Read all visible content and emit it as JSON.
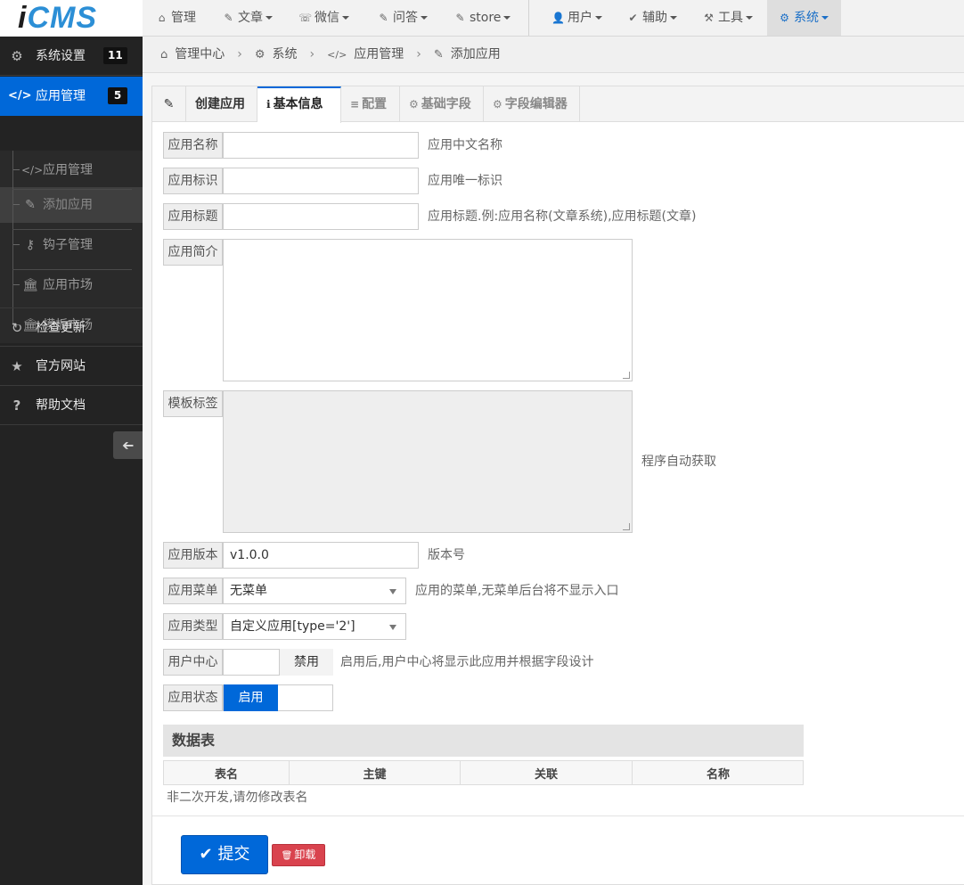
{
  "brand": {
    "logo_i": "i",
    "logo_cms": "CMS"
  },
  "topnav": [
    {
      "icon": "⌂",
      "label": "管理",
      "caret": false
    },
    {
      "icon": "✎",
      "label": "文章",
      "caret": true
    },
    {
      "icon": "☏",
      "label": "微信",
      "caret": true
    },
    {
      "icon": "✎",
      "label": "问答",
      "caret": true
    },
    {
      "icon": "✎",
      "label": "store",
      "caret": true
    },
    {
      "icon": "👤",
      "label": "用户",
      "caret": true
    },
    {
      "icon": "✔",
      "label": "辅助",
      "caret": true
    },
    {
      "icon": "⚒",
      "label": "工具",
      "caret": true
    },
    {
      "icon": "⚙",
      "label": "系统",
      "caret": true,
      "active": true
    }
  ],
  "sidebar": {
    "items": [
      {
        "icon": "⚙",
        "label": "系统设置",
        "badge": "11"
      },
      {
        "icon": "</>",
        "label": "应用管理",
        "badge": "5"
      },
      {
        "icon": "↻",
        "label": "检查更新"
      },
      {
        "icon": "★",
        "label": "官方网站"
      },
      {
        "icon": "?",
        "label": "帮助文档"
      }
    ],
    "sub": [
      {
        "icon": "</>",
        "label": "应用管理"
      },
      {
        "icon": "✎",
        "label": "添加应用"
      },
      {
        "icon": "⚷",
        "label": "钩子管理"
      },
      {
        "icon": "🏛",
        "label": "应用市场"
      },
      {
        "icon": "🏛",
        "label": "模板市场"
      }
    ],
    "collapse_icon": "➔"
  },
  "breadcrumb": [
    {
      "icon": "⌂",
      "label": "管理中心"
    },
    {
      "icon": "⚙",
      "label": "系统"
    },
    {
      "icon": "</>",
      "label": "应用管理"
    },
    {
      "icon": "✎",
      "label": "添加应用"
    }
  ],
  "tabs": {
    "edit_icon": "✎",
    "items": [
      {
        "icon": "",
        "label": "创建应用"
      },
      {
        "icon": "ℹ",
        "label": "基本信息"
      },
      {
        "icon": "≡",
        "label": "配置"
      },
      {
        "icon": "⚙",
        "label": "基础字段"
      },
      {
        "icon": "⚙",
        "label": "字段编辑器"
      }
    ]
  },
  "form": {
    "name": {
      "label": "应用名称",
      "value": "",
      "hint": "应用中文名称"
    },
    "ident": {
      "label": "应用标识",
      "value": "",
      "hint": "应用唯一标识"
    },
    "title": {
      "label": "应用标题",
      "value": "",
      "hint": "应用标题.例:应用名称(文章系统),应用标题(文章)"
    },
    "intro": {
      "label": "应用简介",
      "value": ""
    },
    "tpl": {
      "label": "模板标签",
      "hint": "程序自动获取"
    },
    "version": {
      "label": "应用版本",
      "value": "v1.0.0",
      "hint": "版本号"
    },
    "menu": {
      "label": "应用菜单",
      "selected": "无菜单",
      "hint": "应用的菜单,无菜单后台将不显示入口"
    },
    "type": {
      "label": "应用类型",
      "selected": "自定义应用[type='2']"
    },
    "ucenter": {
      "label": "用户中心",
      "state": "禁用",
      "hint": "启用后,用户中心将显示此应用并根据字段设计"
    },
    "status": {
      "label": "应用状态",
      "state": "启用"
    }
  },
  "datatable": {
    "title": "数据表",
    "columns": [
      "表名",
      "主键",
      "关联",
      "名称"
    ],
    "note": "非二次开发,请勿修改表名"
  },
  "buttons": {
    "submit_icon": "✔",
    "submit": "提交",
    "delete_icon": "🗑",
    "delete": "卸载"
  }
}
